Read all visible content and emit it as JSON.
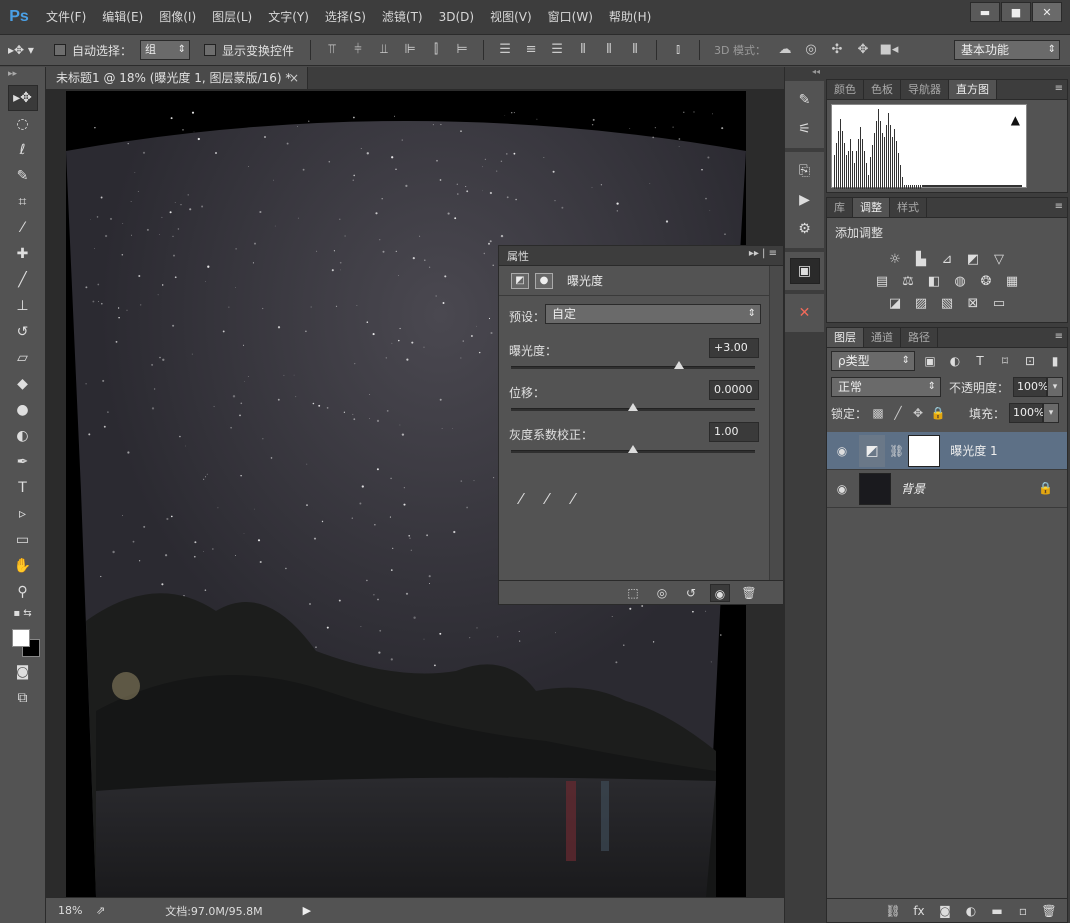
{
  "app": {
    "logo": "Ps"
  },
  "menu": [
    "文件(F)",
    "编辑(E)",
    "图像(I)",
    "图层(L)",
    "文字(Y)",
    "选择(S)",
    "滤镜(T)",
    "3D(D)",
    "视图(V)",
    "窗口(W)",
    "帮助(H)"
  ],
  "window_controls": {
    "minimize": "▬",
    "maximize": "■",
    "close": "✕"
  },
  "options": {
    "auto_select_label": "自动选择：",
    "auto_select_value": "组",
    "show_transform_label": "显示变换控件",
    "mode3d_label": "3D 模式：",
    "workspace": "基本功能"
  },
  "document": {
    "tab_title": "未标题1 @ 18% (曝光度 1, 图层蒙版/16) *",
    "tab_close": "×"
  },
  "status": {
    "zoom": "18%",
    "doc_info": "文档:97.0M/95.8M",
    "arrow": "▶"
  },
  "properties": {
    "panel_title": "属性",
    "header_controls": "▸▸ | ≡",
    "adjustment_name": "曝光度",
    "preset_label": "预设：",
    "preset_value": "自定",
    "exposure": {
      "label": "曝光度：",
      "value": "+3.00",
      "slider_fraction": 0.69
    },
    "offset": {
      "label": "位移：",
      "value": "0.0000",
      "slider_fraction": 0.5
    },
    "gamma": {
      "label": "灰度系数校正：",
      "value": "1.00",
      "slider_fraction": 0.5
    }
  },
  "histogram_panel": {
    "tabs": [
      "颜色",
      "色板",
      "导航器",
      "直方图"
    ],
    "active_tab": "直方图",
    "warning": "▲"
  },
  "adjustments_panel": {
    "tabs": [
      "库",
      "调整",
      "样式"
    ],
    "active_tab": "调整",
    "title": "添加调整"
  },
  "layers_panel": {
    "tabs": [
      "图层",
      "通道",
      "路径"
    ],
    "active_tab": "图层",
    "filter_kind": "ρ类型",
    "blend_mode": "正常",
    "opacity_label": "不透明度：",
    "opacity_value": "100%",
    "lock_label": "锁定：",
    "fill_label": "填充：",
    "fill_value": "100%",
    "layers": [
      {
        "name": "曝光度 1",
        "selected": true
      },
      {
        "name": "背景",
        "selected": false,
        "locked": true
      }
    ]
  },
  "colors": {
    "selected_layer": "#5d7086",
    "panel_bg": "#535353",
    "dark_bg": "#3d3d3d",
    "ps_blue": "#4aa0e6"
  }
}
